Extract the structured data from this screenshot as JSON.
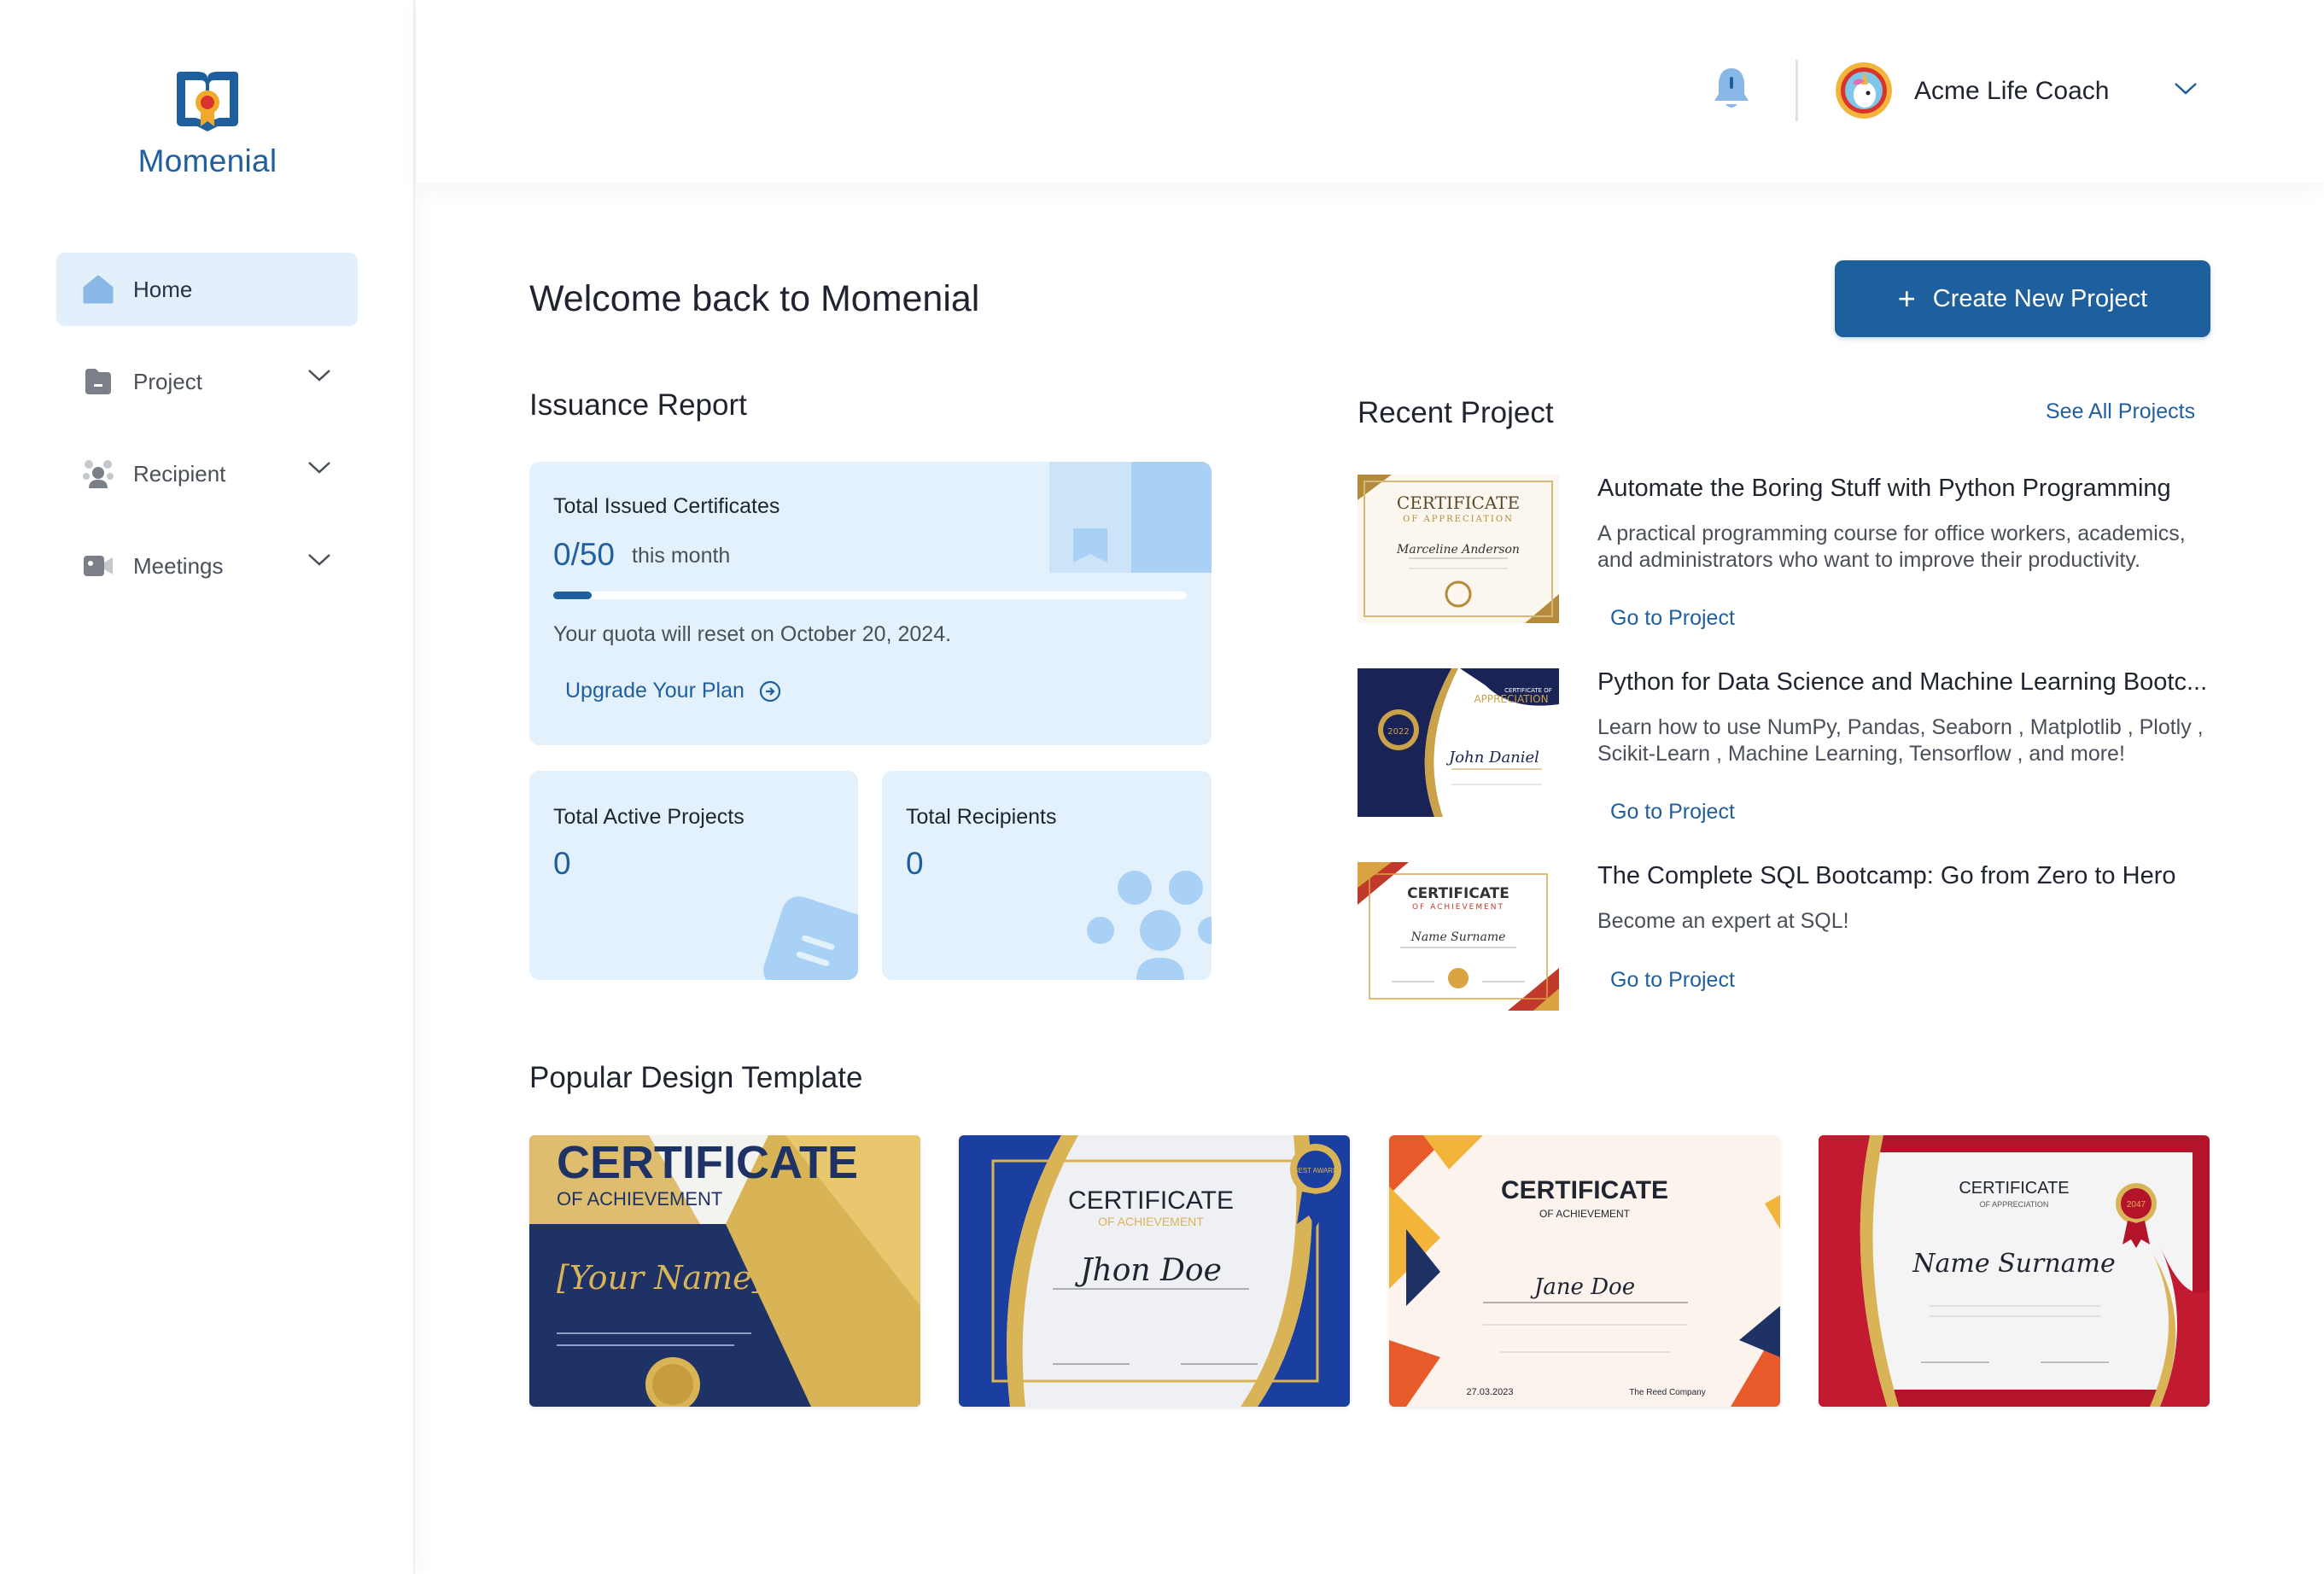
{
  "app": {
    "name": "Momenial"
  },
  "sidebar": {
    "items": [
      {
        "label": "Home",
        "icon": "home-icon",
        "active": true
      },
      {
        "label": "Project",
        "icon": "folder-icon",
        "active": false
      },
      {
        "label": "Recipient",
        "icon": "users-icon",
        "active": false
      },
      {
        "label": "Meetings",
        "icon": "video-icon",
        "active": false
      }
    ]
  },
  "header": {
    "user_name": "Acme Life Coach"
  },
  "main": {
    "title": "Welcome back to Momenial",
    "create_button": "Create New Project",
    "issuance": {
      "title": "Issuance Report",
      "issued_label": "Total Issued Certificates",
      "issued_value": "0/50",
      "issued_period": "this month",
      "progress_fraction": 0.06,
      "reset_text": "Your quota will reset on October 20, 2024.",
      "upgrade_label": "Upgrade Your Plan",
      "active_projects_label": "Total Active Projects",
      "active_projects_value": "0",
      "recipients_label": "Total Recipients",
      "recipients_value": "0"
    },
    "recent": {
      "title": "Recent Project",
      "see_all": "See All Projects",
      "items": [
        {
          "title": "Automate the Boring Stuff with Python Programming",
          "description": "A practical programming course for office workers, academics, and administrators who want to improve their productivity.",
          "link": "Go to Project",
          "thumb": {
            "heading": "CERTIFICATE",
            "sub": "OF APPRECIATION",
            "name": "Marceline Anderson"
          }
        },
        {
          "title": "Python for Data Science and Machine Learning Bootc...",
          "description": "Learn how to use NumPy, Pandas, Seaborn , Matplotlib , Plotly , Scikit-Learn , Machine Learning, Tensorflow , and more!",
          "link": "Go to Project",
          "thumb": {
            "heading": "CERTIFICATE OF",
            "sub": "APPRECIATION",
            "name": "John Daniel",
            "badge": "2022"
          }
        },
        {
          "title": "The Complete SQL Bootcamp: Go from Zero to Hero",
          "description": "Become an expert at SQL!",
          "link": "Go to Project",
          "thumb": {
            "heading": "CERTIFICATE",
            "sub": "OF ACHIEVEMENT",
            "name": "Name Surname"
          }
        }
      ]
    },
    "templates": {
      "title": "Popular Design Template",
      "items": [
        {
          "heading": "CERTIFICATE",
          "sub": "OF ACHIEVEMENT",
          "name": "[Your Name]"
        },
        {
          "heading": "CERTIFICATE",
          "sub": "OF ACHIEVEMENT",
          "name": "Jhon Doe",
          "badge": "BEST AWARD"
        },
        {
          "heading": "CERTIFICATE",
          "sub": "OF ACHIEVEMENT",
          "name": "Jane Doe",
          "date": "27.03.2023",
          "company": "The Reed Company"
        },
        {
          "heading": "CERTIFICATE",
          "sub": "OF APPRECIATION",
          "name": "Name Surname",
          "badge": "2047"
        }
      ]
    }
  },
  "colors": {
    "primary": "#1e5f9e",
    "card_bg": "#e3f1fc",
    "active_nav_bg": "#e3f0fc",
    "text": "#1f2430",
    "muted": "#4a4f5a"
  }
}
